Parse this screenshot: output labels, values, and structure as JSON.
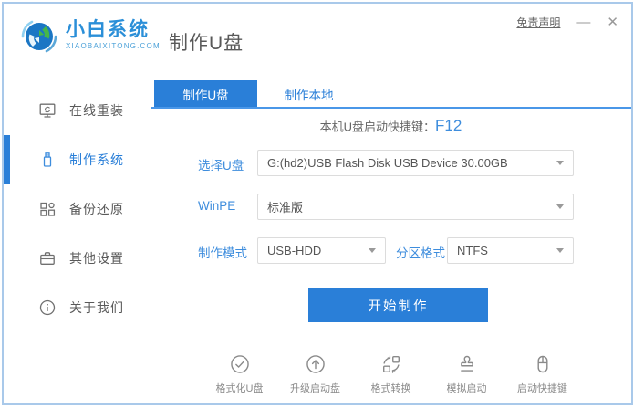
{
  "window": {
    "disclaimer": "免责声明",
    "minimize_glyph": "—",
    "close_glyph": "✕"
  },
  "header": {
    "logo_title": "小白系统",
    "logo_subtitle": "XIAOBAIXITONG.COM",
    "page_title": "制作U盘"
  },
  "sidebar": {
    "items": [
      {
        "label": "在线重装",
        "icon": "monitor-reinstall-icon",
        "active": false
      },
      {
        "label": "制作系统",
        "icon": "usb-drive-icon",
        "active": true
      },
      {
        "label": "备份还原",
        "icon": "backup-restore-icon",
        "active": false
      },
      {
        "label": "其他设置",
        "icon": "briefcase-settings-icon",
        "active": false
      },
      {
        "label": "关于我们",
        "icon": "info-icon",
        "active": false
      }
    ]
  },
  "main": {
    "tabs": [
      {
        "label": "制作U盘",
        "active": true
      },
      {
        "label": "制作本地",
        "active": false
      }
    ],
    "hotkey_label": "本机U盘启动快捷键：",
    "hotkey_value": "F12",
    "form": {
      "usb_label": "选择U盘",
      "usb_value": "G:(hd2)USB Flash Disk USB Device 30.00GB",
      "winpe_label": "WinPE",
      "winpe_value": "标准版",
      "mode_label": "制作模式",
      "mode_value": "USB-HDD",
      "partition_label": "分区格式",
      "partition_value": "NTFS"
    },
    "start_button": "开始制作",
    "toolbar": [
      {
        "label": "格式化U盘",
        "icon": "check-circle-icon"
      },
      {
        "label": "升级启动盘",
        "icon": "arrow-up-circle-icon"
      },
      {
        "label": "格式转换",
        "icon": "convert-icon"
      },
      {
        "label": "模拟启动",
        "icon": "stamp-icon"
      },
      {
        "label": "启动快捷键",
        "icon": "mouse-icon"
      }
    ]
  },
  "colors": {
    "primary": "#2a7fd8",
    "accent_text": "#3e8ddd",
    "tab_underline": "#4a97e8",
    "window_border": "#a9c9ea",
    "field_border": "#dcdcdc",
    "icon_gray": "#8a8a8a"
  }
}
